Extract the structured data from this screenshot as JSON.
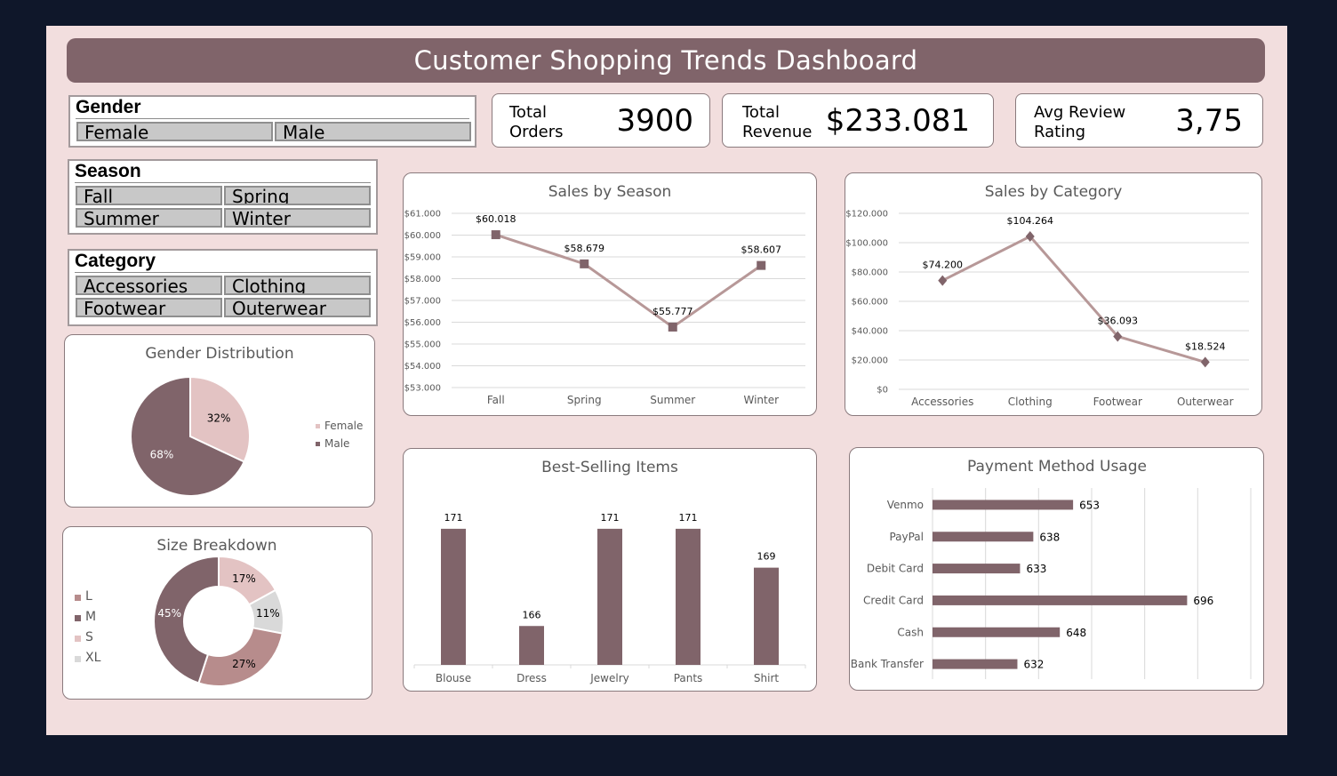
{
  "dashboard": {
    "title": "Customer Shopping Trends Dashboard"
  },
  "slicers": {
    "gender": {
      "title": "Gender",
      "options": [
        "Female",
        "Male"
      ]
    },
    "season": {
      "title": "Season",
      "options": [
        "Fall",
        "Spring",
        "Summer",
        "Winter"
      ]
    },
    "category": {
      "title": "Category",
      "options": [
        "Accessories",
        "Clothing",
        "Footwear",
        "Outerwear"
      ]
    }
  },
  "kpis": {
    "orders": {
      "label1": "Total",
      "label2": "Orders",
      "value": "3900"
    },
    "revenue": {
      "label1": "Total",
      "label2": "Revenue",
      "value": "$233.081"
    },
    "rating": {
      "label1": "Avg Review",
      "label2": "Rating",
      "value": "3,75"
    }
  },
  "colors": {
    "accent": "#80646a",
    "line": "#b79898",
    "background": "#f2dede"
  },
  "chart_data": [
    {
      "id": "gender",
      "type": "pie",
      "title": "Gender Distribution",
      "categories": [
        "Female",
        "Male"
      ],
      "values": [
        32,
        68
      ],
      "labels": [
        "32%",
        "68%"
      ],
      "colors": [
        "#e3c3c3",
        "#80646a"
      ],
      "legend": "right"
    },
    {
      "id": "size",
      "type": "pie",
      "title": "Size Breakdown",
      "categories": [
        "L",
        "M",
        "S",
        "XL"
      ],
      "values": [
        27,
        45,
        17,
        11
      ],
      "labels": [
        "27%",
        "45%",
        "17%",
        "11%"
      ],
      "colors": [
        "#b78c8c",
        "#80646a",
        "#e3c3c3",
        "#d9d9d9"
      ],
      "legend": "left"
    },
    {
      "id": "season",
      "type": "line",
      "title": "Sales by Season",
      "categories": [
        "Fall",
        "Spring",
        "Summer",
        "Winter"
      ],
      "values": [
        60018,
        58679,
        55777,
        58607
      ],
      "labels": [
        "$60.018",
        "$58.679",
        "$55.777",
        "$58.607"
      ],
      "ylim": [
        53000,
        61000
      ],
      "yticks": [
        "$53.000",
        "$54.000",
        "$55.000",
        "$56.000",
        "$57.000",
        "$58.000",
        "$59.000",
        "$60.000",
        "$61.000"
      ],
      "marker": "square",
      "grid": true
    },
    {
      "id": "category",
      "type": "line",
      "title": "Sales by Category",
      "categories": [
        "Accessories",
        "Clothing",
        "Footwear",
        "Outerwear"
      ],
      "values": [
        74200,
        104264,
        36093,
        18524
      ],
      "labels": [
        "$74.200",
        "$104.264",
        "$36.093",
        "$18.524"
      ],
      "ylim": [
        0,
        120000
      ],
      "yticks": [
        "$0",
        "$20.000",
        "$40.000",
        "$60.000",
        "$80.000",
        "$100.000",
        "$120.000"
      ],
      "marker": "diamond",
      "grid": true
    },
    {
      "id": "items",
      "type": "bar",
      "title": "Best-Selling Items",
      "categories": [
        "Blouse",
        "Dress",
        "Jewelry",
        "Pants",
        "Shirt"
      ],
      "values": [
        171,
        166,
        171,
        171,
        169
      ],
      "labels": [
        "171",
        "166",
        "171",
        "171",
        "169"
      ],
      "ylim": [
        164,
        172
      ]
    },
    {
      "id": "payment",
      "type": "bar",
      "orientation": "horizontal",
      "title": "Payment Method Usage",
      "categories": [
        "Venmo",
        "PayPal",
        "Debit Card",
        "Credit Card",
        "Cash",
        "Bank Transfer"
      ],
      "values": [
        653,
        638,
        633,
        696,
        648,
        632
      ],
      "labels": [
        "653",
        "638",
        "633",
        "696",
        "648",
        "632"
      ],
      "xlim": [
        600,
        720
      ],
      "grid": true
    }
  ]
}
